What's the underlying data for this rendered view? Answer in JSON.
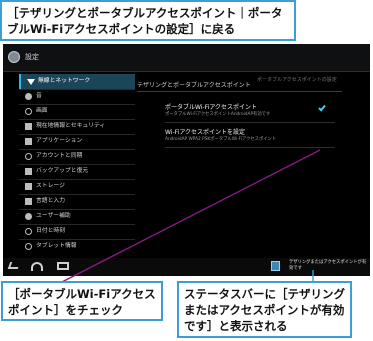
{
  "callouts": {
    "top": "［テザリングとポータブルアクセスポイント｜ポータブルWi-Fiアクセスポイントの設定］に戻る",
    "bottom_left": "［ポータブルWi-Fiアクセスポイント］をチェック",
    "bottom_right": "ステータスバーに［テザリングまたはアクセスポイントが有効です］と表示される"
  },
  "app": {
    "title": "設定"
  },
  "sidebar": {
    "items": [
      {
        "label": "無線とネットワーク",
        "icon": "wireless-icon",
        "active": true
      },
      {
        "label": "音",
        "icon": "sound-icon"
      },
      {
        "label": "画面",
        "icon": "display-icon"
      },
      {
        "label": "現在地情報とセキュリティ",
        "icon": "location-icon"
      },
      {
        "label": "アプリケーション",
        "icon": "apps-icon"
      },
      {
        "label": "アカウントと同期",
        "icon": "sync-icon"
      },
      {
        "label": "バックアップと復元",
        "icon": "backup-icon"
      },
      {
        "label": "ストレージ",
        "icon": "storage-icon"
      },
      {
        "label": "言語と入力",
        "icon": "language-icon"
      },
      {
        "label": "ユーザー補助",
        "icon": "accessibility-icon"
      },
      {
        "label": "日付と時刻",
        "icon": "clock-icon"
      },
      {
        "label": "タブレット情報",
        "icon": "info-icon"
      }
    ]
  },
  "content": {
    "heading": "テザリングとポータブルアクセスポイント",
    "heading_right": "ポータブルアクセスポイントの設定",
    "rows": [
      {
        "title": "ポータブルWi-Fiアクセスポイント",
        "subtitle": "ポータブルWi-FiアクセスポイントAndroidAP有効です"
      },
      {
        "title": "Wi-Fiアクセスポイントを設定",
        "subtitle": "AndroidAP WPA2 PSKポータブルWi-Fiアクセスポイント"
      }
    ],
    "checkbox_checked": true
  },
  "statusbar": {
    "notification_text": "テザリングまたはアクセスポイントが有効です"
  },
  "colors": {
    "callout_border": "#3a9fd6",
    "accent": "#34d3f1",
    "pointer_line": "#8a1a86"
  }
}
